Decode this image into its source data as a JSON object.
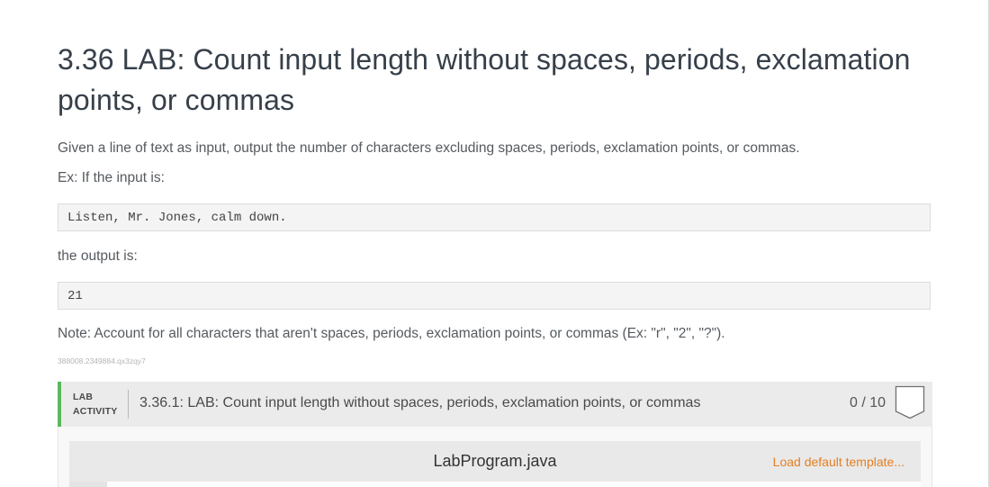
{
  "page": {
    "title": "3.36 LAB: Count input length without spaces, periods, exclamation points, or commas",
    "description": "Given a line of text as input, output the number of characters excluding spaces, periods, exclamation points, or commas.",
    "example_intro": "Ex: If the input is:",
    "example_input": "Listen, Mr. Jones, calm down.",
    "output_intro": "the output is:",
    "example_output": "21",
    "note": "Note: Account for all characters that aren't spaces, periods, exclamation points, or commas (Ex: \"r\", \"2\", \"?\").",
    "content_id": "388008.2349884.qx3zqy7"
  },
  "lab": {
    "label_line1": "LAB",
    "label_line2": "ACTIVITY",
    "title": "3.36.1: LAB: Count input length without spaces, periods, exclamation points, or commas",
    "score": "0 / 10",
    "badge_icon": "empty-badge-icon",
    "accent_color": "#5cb85c"
  },
  "editor": {
    "file_name": "LabProgram.java",
    "load_default": "Load default template..."
  }
}
